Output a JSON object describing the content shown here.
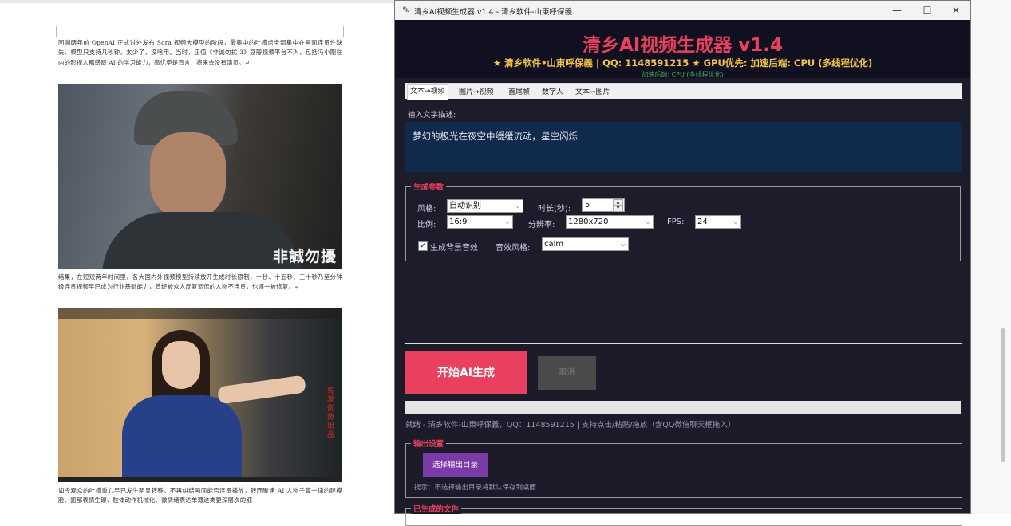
{
  "document": {
    "para1": "回溯两年前 OpenAI 正式对外发布 Sora 视频大模型的阶段，最集中的吐槽点全部集中在画面连贯性缺失、模型只支持几秒钟，太少了，没啥用。当时，正值《非诚勿扰 3》豆瓣视频平台不入，包括冯小刚在内的影视人都感慨 AI 的学习能力，高优更是直言，将来会没有演员。↵",
    "caption1": "非誠勿擾",
    "para2": "结果，在短短两年时间里，各大国内外视频模型持续放开生成时长限制，十秒、十五秒、三十秒乃至分钟级连贯视频早已成为行业基础能力，曾经被众人反复调侃的人物不连贯，也逐一被修复。↵",
    "vertical_text": "先发优势出品",
    "para3": "如今观众的吐槽重心早已发生明显转移，不再纠结画面能否连贯播放，转而聚焦 AI 人物千篇一律的建模脸、面部表情生硬、肢体动作机械化、微情绪表达单薄这类更深层次的细"
  },
  "window": {
    "title": "清乡AI视频生成器 v1.4 - 清乡软件-山東呼保義",
    "min": "—",
    "max": "☐",
    "close": "✕"
  },
  "header": {
    "title": "清乡AI视频生成器 v1.4",
    "subtitle": "★ 清乡软件•山東呼保義 | QQ: 1148591215 ★ GPU优先: 加速后端: CPU (多线程优化)",
    "backend": "加速后端: CPU (多线程优化)"
  },
  "tabs": [
    "文本→视频",
    "图片→视频",
    "首尾帧",
    "数字人",
    "文本→图片"
  ],
  "input": {
    "label": "输入文字描述:",
    "value": "梦幻的极光在夜空中缓缓流动，星空闪烁"
  },
  "params": {
    "legend": "生成参数",
    "style_label": "风格:",
    "style_value": "自动识别",
    "duration_label": "时长(秒):",
    "duration_value": "5",
    "ratio_label": "比例:",
    "ratio_value": "16:9",
    "resolution_label": "分辨率:",
    "resolution_value": "1280x720",
    "fps_label": "FPS:",
    "fps_value": "24",
    "bgm_label": "生成背景音效",
    "bgm_checked": true,
    "sfx_label": "音效风格:",
    "sfx_value": "calm"
  },
  "actions": {
    "start": "开始AI生成",
    "cancel": "取消"
  },
  "progress": 0,
  "status": "就绪 - 清乡软件-山東呼保義，QQ：1148591215 | 支持点击/粘贴/拖放（含QQ微信聊天框拖入）",
  "output": {
    "legend": "输出设置",
    "choose_dir": "选择输出目录",
    "hint": "提示：不选择输出目录将默认保存到桌面"
  },
  "files": {
    "legend": "已生成的文件"
  },
  "colors": {
    "accent": "#e8405e",
    "gold": "#f3c34a",
    "green": "#3fae5a",
    "purple": "#7c3aa8",
    "bg": "#1b1b29"
  }
}
